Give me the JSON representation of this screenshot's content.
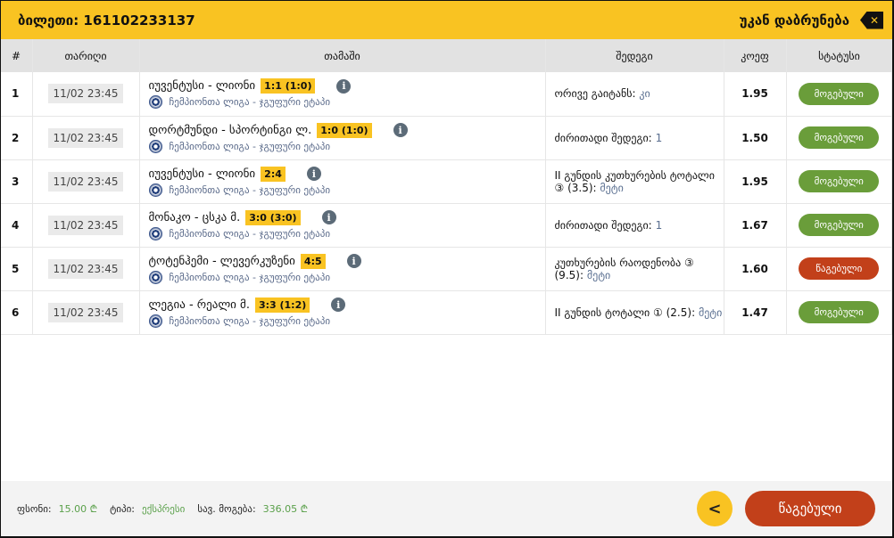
{
  "header": {
    "ticket_label": "ბილეთი: 161102233137",
    "back_label": "უკან დაბრუნება"
  },
  "columns": [
    "#",
    "თარიღი",
    "თამაში",
    "შედეგი",
    "კოეფ",
    "სტატუსი"
  ],
  "rows": [
    {
      "n": "1",
      "date": "11/02 23:45",
      "match": "იუვენტუსი - ლიონი",
      "score": "1:1 (1:0)",
      "league": "ჩემპიონთა ლიგა - ჯგუფური ეტაპი",
      "market": "ორივე გაიტანს:",
      "pick": "კი",
      "odds": "1.95",
      "status": "მოგებული",
      "won": true
    },
    {
      "n": "2",
      "date": "11/02 23:45",
      "match": "დორტმუნდი - სპორტინგი ლ.",
      "score": "1:0 (1:0)",
      "league": "ჩემპიონთა ლიგა - ჯგუფური ეტაპი",
      "market": "ძირითადი შედეგი:",
      "pick": "1",
      "odds": "1.50",
      "status": "მოგებული",
      "won": true
    },
    {
      "n": "3",
      "date": "11/02 23:45",
      "match": "იუვენტუსი - ლიონი",
      "score": "2:4",
      "league": "ჩემპიონთა ლიგა - ჯგუფური ეტაპი",
      "market": "II გუნდის კუთხურების ტოტალი ③ (3.5):",
      "pick": "მეტი",
      "odds": "1.95",
      "status": "მოგებული",
      "won": true
    },
    {
      "n": "4",
      "date": "11/02 23:45",
      "match": "მონაკო - ცსკა მ.",
      "score": "3:0 (3:0)",
      "league": "ჩემპიონთა ლიგა - ჯგუფური ეტაპი",
      "market": "ძირითადი შედეგი:",
      "pick": "1",
      "odds": "1.67",
      "status": "მოგებული",
      "won": true
    },
    {
      "n": "5",
      "date": "11/02 23:45",
      "match": "ტოტენჰემი - ლევერკუზენი",
      "score": "4:5",
      "league": "ჩემპიონთა ლიგა - ჯგუფური ეტაპი",
      "market": "კუთხურების რაოდენობა ③ (9.5):",
      "pick": "მეტი",
      "odds": "1.60",
      "status": "წაგებული",
      "won": false
    },
    {
      "n": "6",
      "date": "11/02 23:45",
      "match": "ლეგია - რეალი მ.",
      "score": "3:3 (1:2)",
      "league": "ჩემპიონთა ლიგა - ჯგუფური ეტაპი",
      "market": "II გუნდის ტოტალი ① (2.5):",
      "pick": "მეტი",
      "odds": "1.47",
      "status": "მოგებული",
      "won": true
    }
  ],
  "footer": {
    "stake_label": "ფსონი:",
    "stake": "15.00 ₾",
    "type_label": "ტიპი:",
    "type": "ექსპრესი",
    "win_label": "სავ. მოგება:",
    "win": "336.05 ₾",
    "result_button": "წაგებული"
  },
  "colors": {
    "accent": "#f9c322",
    "won": "#6a9d3a",
    "lost": "#c2401a"
  }
}
